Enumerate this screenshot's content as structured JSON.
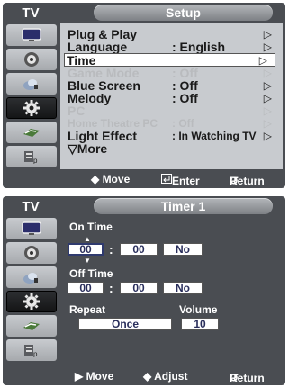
{
  "setup": {
    "tv_label": "TV",
    "title": "Setup",
    "items": [
      {
        "label": "Plug & Play",
        "value": "",
        "arrow": "▷"
      },
      {
        "label": "Language",
        "value": ": English",
        "arrow": "▷"
      },
      {
        "label": "Time",
        "value": "",
        "arrow": "▷"
      },
      {
        "label": "Game Mode",
        "value": ": Off",
        "arrow": "▷"
      },
      {
        "label": "Blue Screen",
        "value": ": Off",
        "arrow": "▷"
      },
      {
        "label": "Melody",
        "value": ": Off",
        "arrow": "▷"
      },
      {
        "label": "PC",
        "value": "",
        "arrow": "▷"
      },
      {
        "label": "Home Theatre PC",
        "value": ": Off",
        "arrow": "▷"
      },
      {
        "label": "Light Effect",
        "value": ": In Watching TV",
        "arrow": "▷"
      },
      {
        "label": "▽More",
        "value": "",
        "arrow": ""
      }
    ],
    "bottom": {
      "move": "◆ Move",
      "enter": "Enter",
      "return": "Return"
    }
  },
  "timer": {
    "tv_label": "TV",
    "title": "Timer 1",
    "on_time_label": "On Time",
    "on_hour": "00",
    "on_min": "00",
    "on_flag": "No",
    "off_time_label": "Off Time",
    "off_hour": "00",
    "off_min": "00",
    "off_flag": "No",
    "repeat_label": "Repeat",
    "repeat_value": "Once",
    "volume_label": "Volume",
    "volume_value": "10",
    "colon": ":",
    "bottom": {
      "move": "▶ Move",
      "adjust": "◆ Adjust",
      "return": "Return"
    }
  },
  "sidebar_icons": [
    "picture-icon",
    "sound-icon",
    "channel-icon",
    "setup-icon",
    "input-icon",
    "application-icon"
  ],
  "colors": {
    "panel": "#4a4d52",
    "content": "#c8cbcf",
    "title_pill": "#9a9da1",
    "active_icon": "#1e1f21"
  }
}
